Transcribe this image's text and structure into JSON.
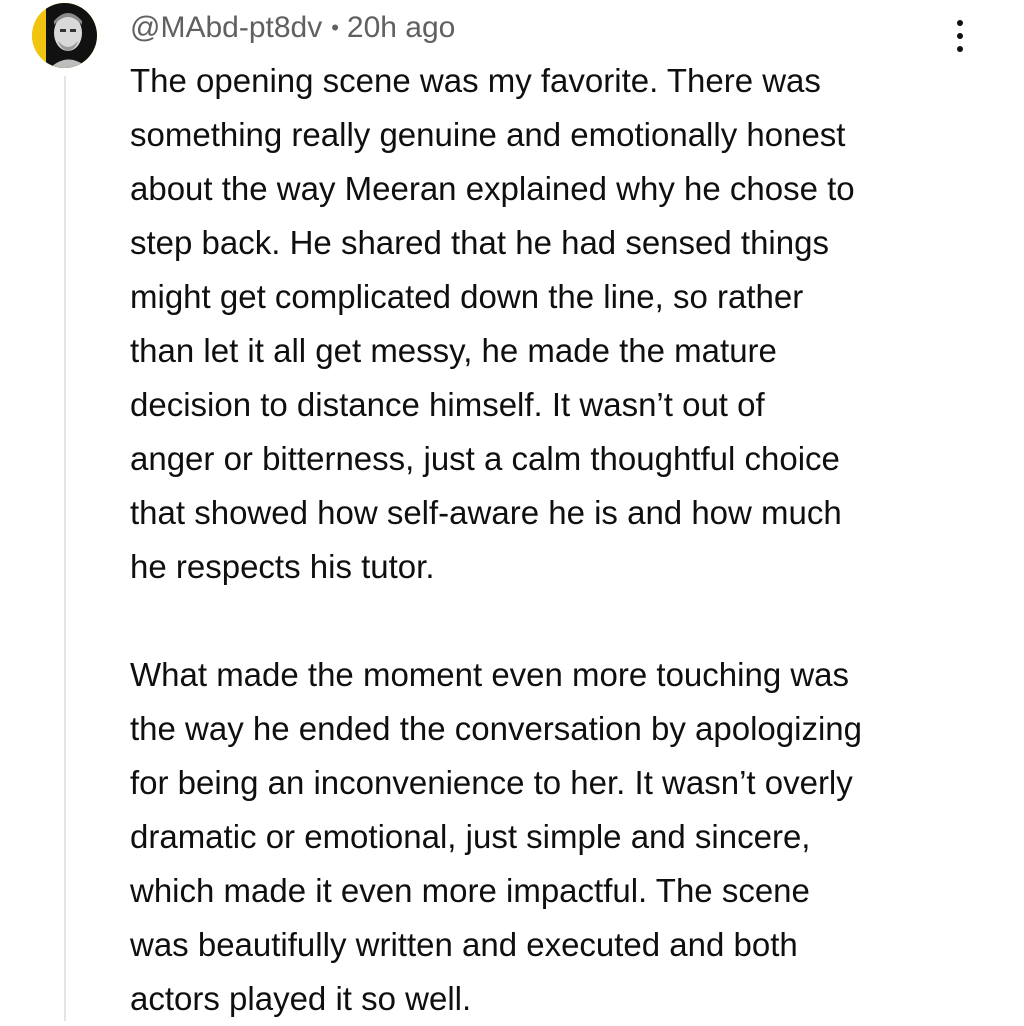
{
  "comment": {
    "author": "@MAbd-pt8dv",
    "separator": "•",
    "time": "20h ago",
    "avatar_icon": "user-avatar-portrait",
    "menu_icon": "more-vert-icon",
    "paragraph1": [
      "The opening scene was my favorite. There was",
      "something really genuine and emotionally honest",
      "about the way Meeran explained why he chose to",
      "step back. He shared that he had sensed things",
      "might get complicated down the line, so rather",
      "than let it all get messy, he made the mature",
      "decision to distance himself. It wasn’t out of",
      "anger or bitterness, just a calm thoughtful choice",
      "that showed how self-aware he is and how much",
      "he respects his tutor."
    ],
    "paragraph2": [
      "What made the moment even more touching was",
      "the way he ended the conversation by apologizing",
      "for being an inconvenience to her. It wasn’t overly",
      "dramatic or emotional, just simple and sincere,",
      "which made it even more impactful. The scene",
      "was beautifully written and executed and both",
      "actors played it so well."
    ]
  }
}
